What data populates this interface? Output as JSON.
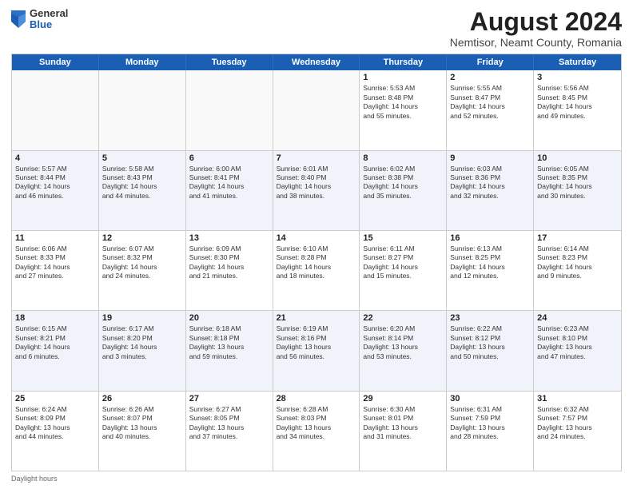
{
  "header": {
    "logo": {
      "general": "General",
      "blue": "Blue"
    },
    "title": "August 2024",
    "subtitle": "Nemtisor, Neamt County, Romania"
  },
  "calendar": {
    "days_of_week": [
      "Sunday",
      "Monday",
      "Tuesday",
      "Wednesday",
      "Thursday",
      "Friday",
      "Saturday"
    ],
    "footer": "Daylight hours",
    "weeks": [
      [
        {
          "day": "",
          "info": ""
        },
        {
          "day": "",
          "info": ""
        },
        {
          "day": "",
          "info": ""
        },
        {
          "day": "",
          "info": ""
        },
        {
          "day": "1",
          "info": "Sunrise: 5:53 AM\nSunset: 8:48 PM\nDaylight: 14 hours\nand 55 minutes."
        },
        {
          "day": "2",
          "info": "Sunrise: 5:55 AM\nSunset: 8:47 PM\nDaylight: 14 hours\nand 52 minutes."
        },
        {
          "day": "3",
          "info": "Sunrise: 5:56 AM\nSunset: 8:45 PM\nDaylight: 14 hours\nand 49 minutes."
        }
      ],
      [
        {
          "day": "4",
          "info": "Sunrise: 5:57 AM\nSunset: 8:44 PM\nDaylight: 14 hours\nand 46 minutes."
        },
        {
          "day": "5",
          "info": "Sunrise: 5:58 AM\nSunset: 8:43 PM\nDaylight: 14 hours\nand 44 minutes."
        },
        {
          "day": "6",
          "info": "Sunrise: 6:00 AM\nSunset: 8:41 PM\nDaylight: 14 hours\nand 41 minutes."
        },
        {
          "day": "7",
          "info": "Sunrise: 6:01 AM\nSunset: 8:40 PM\nDaylight: 14 hours\nand 38 minutes."
        },
        {
          "day": "8",
          "info": "Sunrise: 6:02 AM\nSunset: 8:38 PM\nDaylight: 14 hours\nand 35 minutes."
        },
        {
          "day": "9",
          "info": "Sunrise: 6:03 AM\nSunset: 8:36 PM\nDaylight: 14 hours\nand 32 minutes."
        },
        {
          "day": "10",
          "info": "Sunrise: 6:05 AM\nSunset: 8:35 PM\nDaylight: 14 hours\nand 30 minutes."
        }
      ],
      [
        {
          "day": "11",
          "info": "Sunrise: 6:06 AM\nSunset: 8:33 PM\nDaylight: 14 hours\nand 27 minutes."
        },
        {
          "day": "12",
          "info": "Sunrise: 6:07 AM\nSunset: 8:32 PM\nDaylight: 14 hours\nand 24 minutes."
        },
        {
          "day": "13",
          "info": "Sunrise: 6:09 AM\nSunset: 8:30 PM\nDaylight: 14 hours\nand 21 minutes."
        },
        {
          "day": "14",
          "info": "Sunrise: 6:10 AM\nSunset: 8:28 PM\nDaylight: 14 hours\nand 18 minutes."
        },
        {
          "day": "15",
          "info": "Sunrise: 6:11 AM\nSunset: 8:27 PM\nDaylight: 14 hours\nand 15 minutes."
        },
        {
          "day": "16",
          "info": "Sunrise: 6:13 AM\nSunset: 8:25 PM\nDaylight: 14 hours\nand 12 minutes."
        },
        {
          "day": "17",
          "info": "Sunrise: 6:14 AM\nSunset: 8:23 PM\nDaylight: 14 hours\nand 9 minutes."
        }
      ],
      [
        {
          "day": "18",
          "info": "Sunrise: 6:15 AM\nSunset: 8:21 PM\nDaylight: 14 hours\nand 6 minutes."
        },
        {
          "day": "19",
          "info": "Sunrise: 6:17 AM\nSunset: 8:20 PM\nDaylight: 14 hours\nand 3 minutes."
        },
        {
          "day": "20",
          "info": "Sunrise: 6:18 AM\nSunset: 8:18 PM\nDaylight: 13 hours\nand 59 minutes."
        },
        {
          "day": "21",
          "info": "Sunrise: 6:19 AM\nSunset: 8:16 PM\nDaylight: 13 hours\nand 56 minutes."
        },
        {
          "day": "22",
          "info": "Sunrise: 6:20 AM\nSunset: 8:14 PM\nDaylight: 13 hours\nand 53 minutes."
        },
        {
          "day": "23",
          "info": "Sunrise: 6:22 AM\nSunset: 8:12 PM\nDaylight: 13 hours\nand 50 minutes."
        },
        {
          "day": "24",
          "info": "Sunrise: 6:23 AM\nSunset: 8:10 PM\nDaylight: 13 hours\nand 47 minutes."
        }
      ],
      [
        {
          "day": "25",
          "info": "Sunrise: 6:24 AM\nSunset: 8:09 PM\nDaylight: 13 hours\nand 44 minutes."
        },
        {
          "day": "26",
          "info": "Sunrise: 6:26 AM\nSunset: 8:07 PM\nDaylight: 13 hours\nand 40 minutes."
        },
        {
          "day": "27",
          "info": "Sunrise: 6:27 AM\nSunset: 8:05 PM\nDaylight: 13 hours\nand 37 minutes."
        },
        {
          "day": "28",
          "info": "Sunrise: 6:28 AM\nSunset: 8:03 PM\nDaylight: 13 hours\nand 34 minutes."
        },
        {
          "day": "29",
          "info": "Sunrise: 6:30 AM\nSunset: 8:01 PM\nDaylight: 13 hours\nand 31 minutes."
        },
        {
          "day": "30",
          "info": "Sunrise: 6:31 AM\nSunset: 7:59 PM\nDaylight: 13 hours\nand 28 minutes."
        },
        {
          "day": "31",
          "info": "Sunrise: 6:32 AM\nSunset: 7:57 PM\nDaylight: 13 hours\nand 24 minutes."
        }
      ]
    ]
  }
}
